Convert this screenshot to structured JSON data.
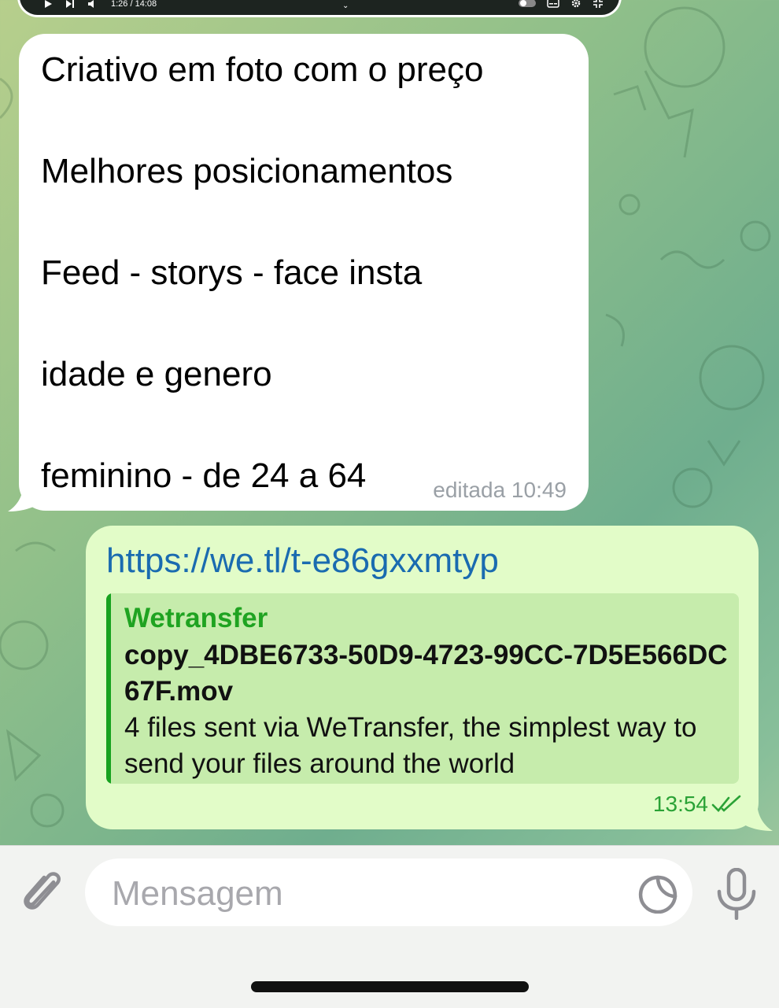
{
  "video": {
    "time": "1:26 / 14:08",
    "icons": [
      "play-icon",
      "next-icon",
      "volume-icon",
      "chevron-down-icon",
      "toggle-icon",
      "subtitles-icon",
      "settings-icon",
      "exit-fullscreen-icon"
    ]
  },
  "incoming": {
    "lines": [
      "Criativo em foto com o preço",
      "Melhores posicionamentos",
      "Feed - storys - face insta",
      "idade e genero",
      "feminino - de 24 a 64"
    ],
    "meta": "editada 10:49"
  },
  "outgoing": {
    "link": "https://we.tl/t-e86gxxmtyp",
    "preview": {
      "site": "Wetransfer",
      "title": "copy_4DBE6733-50D9-4723-99CC-7D5E566DC67F.mov",
      "description": "4 files sent via WeTransfer, the simplest way to send your files around the world"
    },
    "time": "13:54",
    "status_icon": "double-check-icon"
  },
  "composer": {
    "placeholder": "Mensagem",
    "icons": [
      "paperclip-icon",
      "sticker-icon",
      "microphone-icon"
    ]
  },
  "colors": {
    "incoming_bubble": "#ffffff",
    "outgoing_bubble": "#e2fcc8",
    "preview_bg": "#c6ecac",
    "accent_green": "#1fa321",
    "link_blue": "#1a6bb0",
    "meta_grey": "#9aa0a6"
  }
}
